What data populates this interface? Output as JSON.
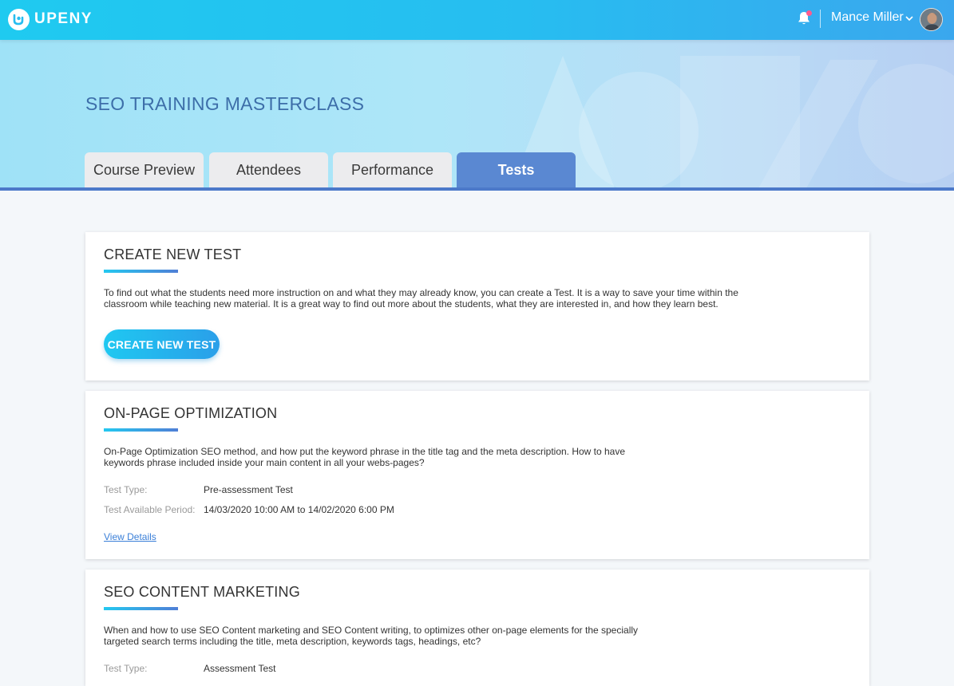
{
  "header": {
    "logo_text": "UPENY",
    "user_name": "Mance Miller",
    "notification_indicator": true
  },
  "course": {
    "title": "SEO TRAINING MASTERCLASS",
    "tabs": [
      {
        "label": "Course Preview",
        "active": false
      },
      {
        "label": "Attendees",
        "active": false
      },
      {
        "label": "Performance",
        "active": false
      },
      {
        "label": "Tests",
        "active": true
      }
    ]
  },
  "create_card": {
    "title": "CREATE NEW TEST",
    "description": "To find out what the students need more instruction on and what they may already know, you can create a Test. It is a way to save your time within the classroom while teaching new material. It is a great way to find out more about the students, what they are interested in, and how they learn best.",
    "button_label": "CREATE NEW TEST"
  },
  "tests": [
    {
      "title": "ON-PAGE OPTIMIZATION",
      "description": "On-Page Optimization SEO method, and how put the keyword phrase in the title tag and the meta description. How to have keywords phrase included inside your main content in all your webs-pages?",
      "type_label": "Test Type:",
      "type_value": "Pre-assessment Test",
      "period_label": "Test Available Period:",
      "period_value": "14/03/2020 10:00 AM to 14/02/2020  6:00 PM",
      "link_label": "View Details"
    },
    {
      "title": "SEO CONTENT MARKETING",
      "description": "When and how to use SEO Content marketing and SEO Content writing, to optimizes other on-page elements for the specially targeted search terms including the title, meta description, keywords tags, headings, etc?",
      "type_label": "Test Type:",
      "type_value": "Assessment Test"
    }
  ],
  "colors": {
    "topbar": "#27bdf0",
    "active_tab": "#5a88d2",
    "title_blue": "#3d6ea9",
    "link": "#3a7fd8"
  }
}
